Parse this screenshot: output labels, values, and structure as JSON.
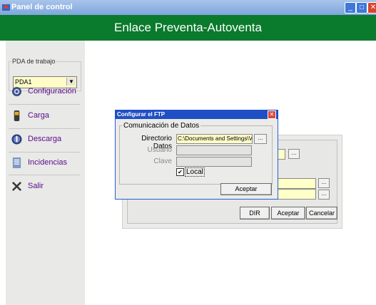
{
  "window": {
    "title": "Panel de control",
    "icon": "app-icon",
    "controls": [
      "minimize",
      "maximize",
      "close"
    ]
  },
  "header": {
    "title": "Enlace Preventa-Autoventa"
  },
  "sidebar": {
    "group_label": "PDA de trabajo",
    "pda_select": {
      "value": "PDA1",
      "arrow": "▼"
    },
    "items": [
      {
        "label": "Configuración",
        "icon": "gear-icon"
      },
      {
        "label": "Carga",
        "icon": "phone-icon"
      },
      {
        "label": "Descarga",
        "icon": "download-icon"
      },
      {
        "label": "Incidencias",
        "icon": "document-icon"
      },
      {
        "label": "Salir",
        "icon": "x-icon"
      }
    ]
  },
  "main": {
    "browse_label": "...",
    "buttons": {
      "dir": "DIR",
      "accept": "Aceptar",
      "cancel": "Cancelar"
    }
  },
  "dialog": {
    "title": "Configurar el FTP",
    "close": "✕",
    "section_label": "Comunicación de Datos",
    "fields": {
      "directorio": {
        "label": "Directorio Datos",
        "value": "C:\\Documents and Settings\\ViR"
      },
      "usuario": {
        "label": "Usuario",
        "value": ""
      },
      "clave": {
        "label": "Clave",
        "value": ""
      }
    },
    "browse_label": "...",
    "local_checkbox": {
      "label": "Local",
      "checked": true,
      "mark": "✔"
    },
    "accept_label": "Aceptar"
  }
}
